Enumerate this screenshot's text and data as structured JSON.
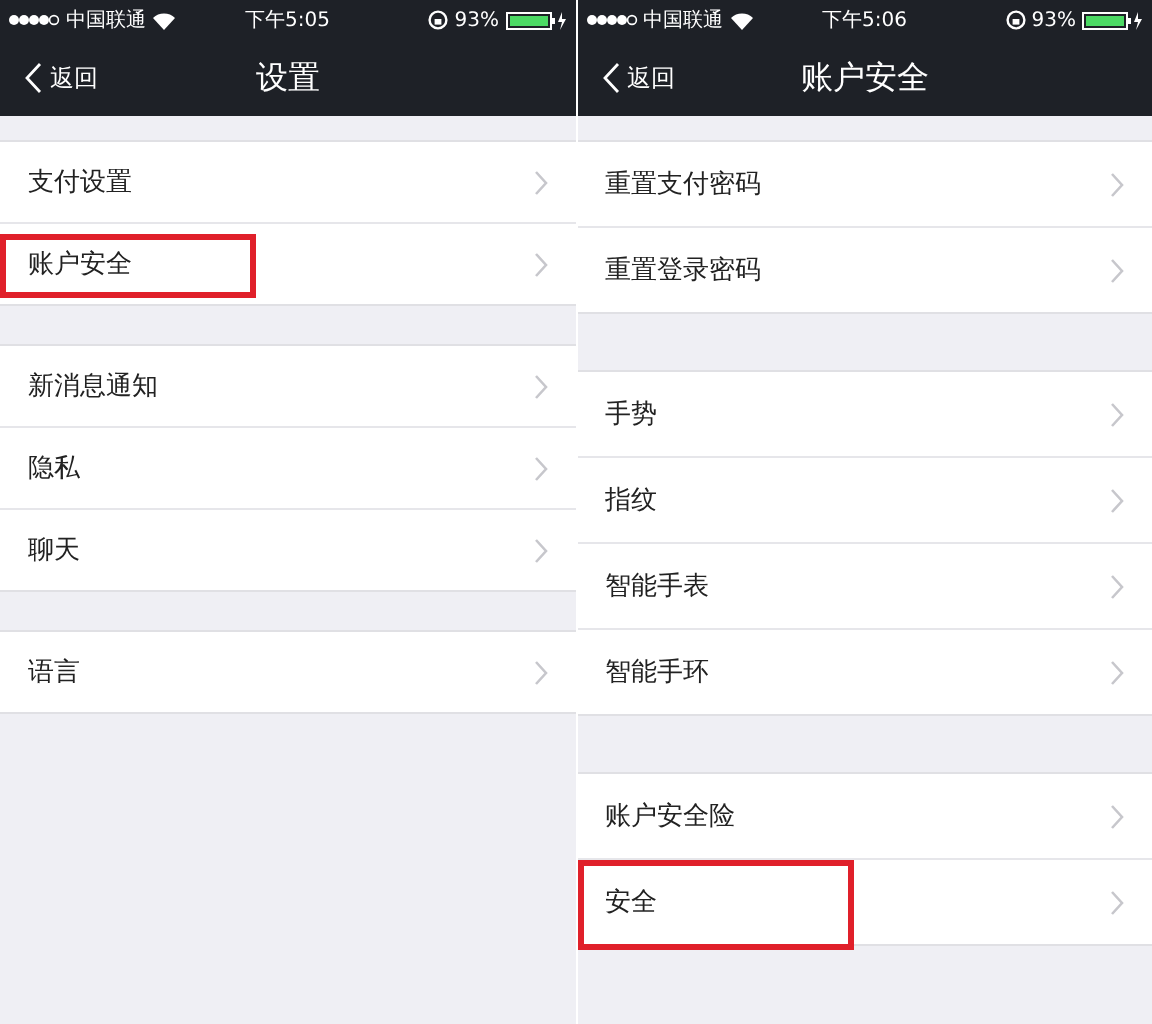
{
  "screens": [
    {
      "status_bar": {
        "carrier": "中国联通",
        "time": "下午5:05",
        "battery": "93%"
      },
      "nav": {
        "back": "返回",
        "title": "设置"
      },
      "sections": [
        [
          {
            "label": "支付设置",
            "highlighted": false
          },
          {
            "label": "账户安全",
            "highlighted": true
          }
        ],
        [
          {
            "label": "新消息通知",
            "highlighted": false
          },
          {
            "label": "隐私",
            "highlighted": false
          },
          {
            "label": "聊天",
            "highlighted": false
          }
        ],
        [
          {
            "label": "语言",
            "highlighted": false
          }
        ]
      ]
    },
    {
      "status_bar": {
        "carrier": "中国联通",
        "time": "下午5:06",
        "battery": "93%"
      },
      "nav": {
        "back": "返回",
        "title": "账户安全"
      },
      "sections": [
        [
          {
            "label": "重置支付密码",
            "highlighted": false
          },
          {
            "label": "重置登录密码",
            "highlighted": false
          }
        ],
        [
          {
            "label": "手势",
            "highlighted": false
          },
          {
            "label": "指纹",
            "highlighted": false
          },
          {
            "label": "智能手表",
            "highlighted": false
          },
          {
            "label": "智能手环",
            "highlighted": false
          }
        ],
        [
          {
            "label": "账户安全险",
            "highlighted": false
          },
          {
            "label": "安全",
            "highlighted": true
          }
        ]
      ]
    }
  ]
}
